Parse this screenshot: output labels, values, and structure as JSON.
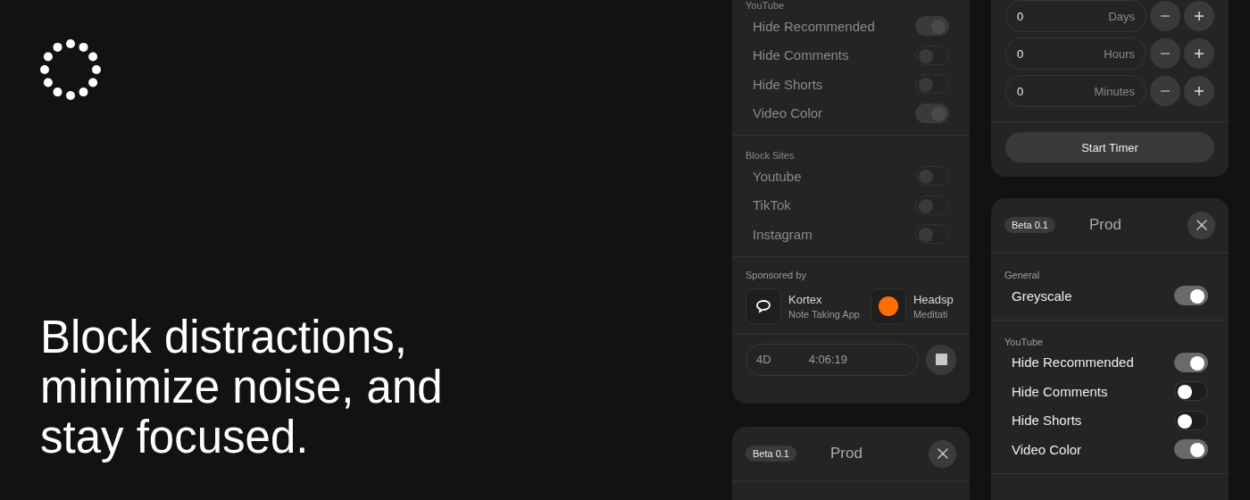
{
  "hero": {
    "headline": "Block distractions, minimize noise, and stay focused."
  },
  "left_panel": {
    "sections": [
      {
        "heading": "YouTube",
        "toggles": [
          {
            "label": "Hide Recommended",
            "on": true
          },
          {
            "label": "Hide Comments",
            "on": false
          },
          {
            "label": "Hide Shorts",
            "on": false
          },
          {
            "label": "Video Color",
            "on": true
          }
        ]
      },
      {
        "heading": "Block Sites",
        "toggles": [
          {
            "label": "Youtube",
            "on": false
          },
          {
            "label": "TikTok",
            "on": false
          },
          {
            "label": "Instagram",
            "on": false
          }
        ]
      }
    ],
    "sponsors": {
      "heading": "Sponsored by",
      "items": [
        {
          "kind": "bubble",
          "name": "Kortex",
          "subtitle": "Note Taking App"
        },
        {
          "kind": "dot",
          "name": "Headsp",
          "subtitle": "Meditati"
        }
      ]
    },
    "timer": {
      "days": "4D",
      "time": "4:06:19"
    }
  },
  "bottom_panel": {
    "badge": "Beta 0.1",
    "title": "Prod"
  },
  "timer_panel": {
    "fields": [
      {
        "value": "0",
        "unit": "Days"
      },
      {
        "value": "0",
        "unit": "Hours"
      },
      {
        "value": "0",
        "unit": "Minutes"
      }
    ],
    "button": "Start Timer"
  },
  "prod_panel": {
    "badge": "Beta 0.1",
    "title": "Prod",
    "sections": [
      {
        "heading": "General",
        "toggles": [
          {
            "label": "Greyscale",
            "on": true
          }
        ]
      },
      {
        "heading": "YouTube",
        "toggles": [
          {
            "label": "Hide Recommended",
            "on": true
          },
          {
            "label": "Hide Comments",
            "on": false
          },
          {
            "label": "Hide Shorts",
            "on": false
          },
          {
            "label": "Video Color",
            "on": true
          }
        ]
      }
    ]
  }
}
